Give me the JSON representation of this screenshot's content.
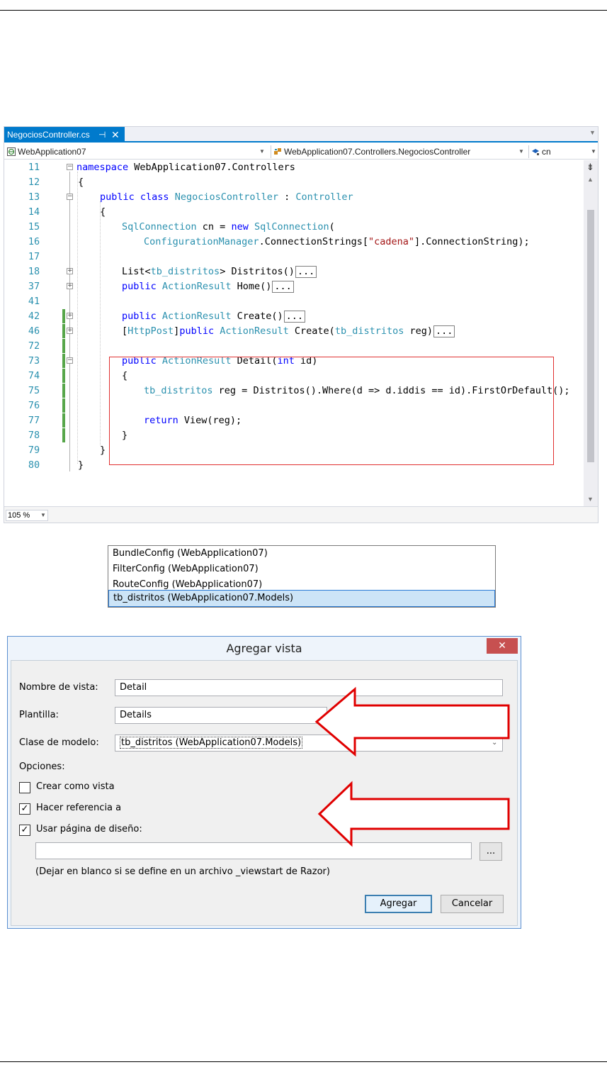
{
  "editor": {
    "tab_title": "NegociosController.cs",
    "tab_pin": "⊣",
    "tab_close": "✕",
    "nav_project": "WebApplication07",
    "nav_class": "WebApplication07.Controllers.NegociosController",
    "nav_member": "cn",
    "zoom": "105 %",
    "lines": [
      {
        "num": "11"
      },
      {
        "num": "12"
      },
      {
        "num": "13"
      },
      {
        "num": "14"
      },
      {
        "num": "15"
      },
      {
        "num": "16"
      },
      {
        "num": "17"
      },
      {
        "num": "18"
      },
      {
        "num": "37"
      },
      {
        "num": "41"
      },
      {
        "num": "42"
      },
      {
        "num": "46"
      },
      {
        "num": "72"
      },
      {
        "num": "73"
      },
      {
        "num": "74"
      },
      {
        "num": "75"
      },
      {
        "num": "76"
      },
      {
        "num": "77"
      },
      {
        "num": "78"
      },
      {
        "num": "79"
      },
      {
        "num": "80"
      }
    ],
    "code": {
      "l11_kw": "namespace",
      "l11_rest": " WebApplication07.Controllers",
      "l12": "{",
      "l13_kw1": "public",
      "l13_kw2": " class ",
      "l13_type": "NegociosController",
      "l13_colon": " : ",
      "l13_base": "Controller",
      "l14": "{",
      "l15_type": "SqlConnection",
      "l15_mid": " cn = ",
      "l15_kw": "new",
      "l15_sp": " ",
      "l15_type2": "SqlConnection",
      "l15_end": "(",
      "l16_type": "ConfigurationManager",
      "l16_mid": ".ConnectionStrings[",
      "l16_str": "\"cadena\"",
      "l16_end": "].ConnectionString);",
      "l18_a": "List<",
      "l18_type": "tb_distritos",
      "l18_b": "> Distritos()",
      "l37_kw": "public",
      "l37_sp": " ",
      "l37_type": "ActionResult",
      "l37_rest": " Home()",
      "l42_kw": "public",
      "l42_sp": " ",
      "l42_type": "ActionResult",
      "l42_rest": " Create()",
      "l46_a": "[",
      "l46_attr": "HttpPost",
      "l46_b": "]",
      "l46_kw": "public",
      "l46_sp": " ",
      "l46_type": "ActionResult",
      "l46_c": " Create(",
      "l46_type2": "tb_distritos",
      "l46_d": " reg)",
      "l73_kw": "public",
      "l73_sp": " ",
      "l73_type": "ActionResult",
      "l73_a": " Detail(",
      "l73_kw2": "int",
      "l73_b": " id)",
      "l74": "{",
      "l75_type": "tb_distritos",
      "l75_rest": " reg = Distritos().Where(d => d.iddis == id).FirstOrDefault();",
      "l77_kw": "return",
      "l77_rest": " View(reg);",
      "l78": "}",
      "l79": "}",
      "l80": "}",
      "collapsed": "..."
    }
  },
  "dialog": {
    "title": "Agregar vista",
    "close": "✕",
    "view_name_label": "Nombre de vista:",
    "view_name_value": "Detail",
    "template_label": "Plantilla:",
    "template_value": "Details",
    "model_class_label": "Clase de modelo:",
    "model_class_value": "tb_distritos (WebApplication07.Models)",
    "options_label": "Opciones:",
    "model_options": [
      {
        "label": "BundleConfig (WebApplication07)"
      },
      {
        "label": "FilterConfig (WebApplication07)"
      },
      {
        "label": "RouteConfig (WebApplication07)"
      },
      {
        "label": "tb_distritos (WebApplication07.Models)"
      }
    ],
    "option_partial": {
      "label": "Crear como vista",
      "checked": false
    },
    "option_scripts": {
      "label": "Hacer referencia a",
      "checked": true
    },
    "option_layout": {
      "label": "Usar página de diseño:",
      "checked": true
    },
    "layout_path": "",
    "browse": "...",
    "hint": "(Dejar en blanco si se define en un archivo _viewstart de Razor)",
    "add_button": "Agregar",
    "cancel_button": "Cancelar",
    "check_glyph": "✓"
  },
  "colors": {
    "tab_accent": "#007acc",
    "keyword": "#0000ff",
    "type": "#2b91af",
    "string": "#a31515",
    "line_number": "#2b91af",
    "change_marker": "#57a64a",
    "highlight_box": "#e03030",
    "arrow": "#e00000"
  }
}
